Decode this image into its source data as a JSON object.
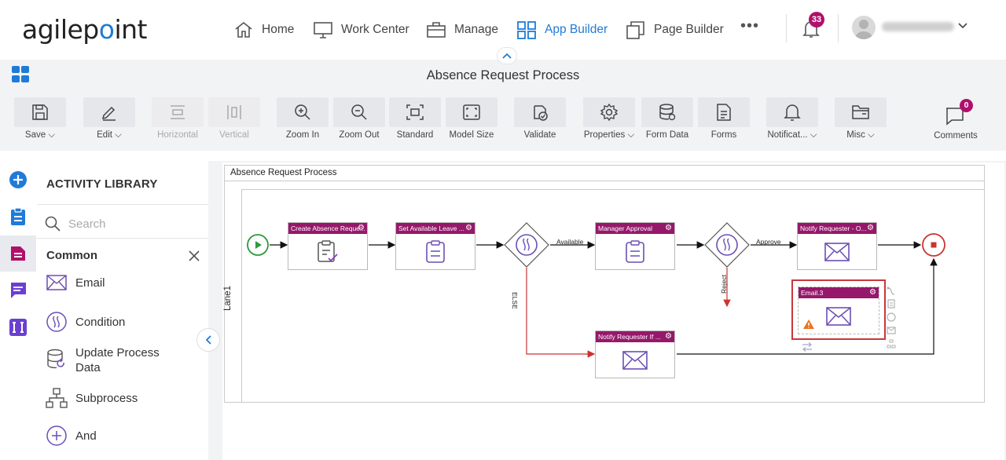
{
  "brand": {
    "logo_text_a": "agilep",
    "logo_text_b": "int"
  },
  "nav": {
    "home": "Home",
    "work_center": "Work Center",
    "manage": "Manage",
    "app_builder": "App Builder",
    "page_builder": "Page Builder",
    "more": "•••",
    "notification_count": "33",
    "accent_color": "#1f7bd8"
  },
  "page_title": "Absence Request Process",
  "toolbar": {
    "save": "Save",
    "edit": "Edit",
    "horizontal": "Horizontal",
    "vertical": "Vertical",
    "zoom_in": "Zoom In",
    "zoom_out": "Zoom Out",
    "standard": "Standard",
    "model_size": "Model Size",
    "validate": "Validate",
    "properties": "Properties",
    "form_data": "Form Data",
    "forms": "Forms",
    "notifications": "Notificat...",
    "misc": "Misc",
    "comments": "Comments",
    "comments_count": "0"
  },
  "library": {
    "heading": "ACTIVITY LIBRARY",
    "search_placeholder": "Search",
    "category": "Common",
    "items": [
      {
        "label": "Email",
        "icon": "email-icon"
      },
      {
        "label": "Condition",
        "icon": "condition-icon"
      },
      {
        "label": "Update Process Data",
        "icon": "update-data-icon"
      },
      {
        "label": "Subprocess",
        "icon": "subprocess-icon"
      },
      {
        "label": "And",
        "icon": "and-icon"
      }
    ]
  },
  "diagram": {
    "pool_title": "Absence Request Process",
    "lane": "Lane1",
    "header_color": "#96186b",
    "nodes": {
      "create_request": "Create Absence Reque...",
      "set_leave": "Set Available Leave ...",
      "manager_approval": "Manager Approval",
      "notify_requester": "Notify Requester - O...",
      "email3": "Email.3",
      "notify_if": "Notify Requester If ..."
    },
    "flows": {
      "available": "Available",
      "approve": "Approve",
      "else": "ELSE",
      "reject": "Reject"
    }
  }
}
